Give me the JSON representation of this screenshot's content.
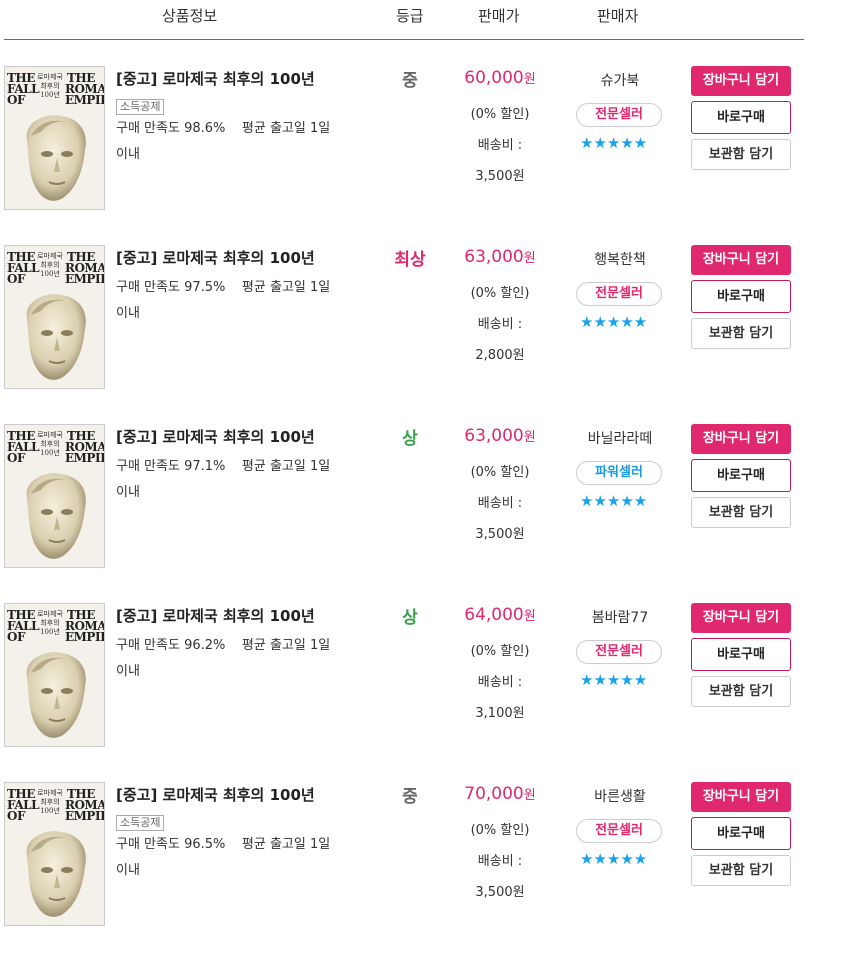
{
  "header": {
    "product_info": "상품정보",
    "grade": "등급",
    "price": "판매가",
    "seller": "판매자"
  },
  "cover": {
    "title_en_left": [
      "THE",
      "FALL",
      "OF"
    ],
    "title_en_right": [
      "THE",
      "ROMAN",
      "EMPIRE"
    ],
    "title_kr": [
      "로마제국",
      "최후의",
      "100년"
    ]
  },
  "labels": {
    "cart": "장바구니 담기",
    "buy": "바로구매",
    "wish": "보관함 담기",
    "deduction": "소득공제",
    "discount": "(0% 할인)",
    "shipping": "배송비 :",
    "won": "원",
    "stars": "★★★★★"
  },
  "colors": {
    "accent": "#e0286e",
    "power": "#1a9bdc",
    "grade_mid": "#666666",
    "grade_best": "#e0286e",
    "grade_high": "#3aa04a",
    "divider": "#1a8a93"
  },
  "items": [
    {
      "title": "[중고] 로마제국 최후의 100년",
      "deduction": true,
      "satisfaction": "구매 만족도 98.6%",
      "ship_time": "평균 출고일 1일",
      "ship_time2": "이내",
      "grade": "중",
      "grade_color": "#666666",
      "price": "60,000",
      "shipping_fee": "3,500원",
      "seller": "슈가북",
      "badge": "전문셀러",
      "badge_type": "pro"
    },
    {
      "title": "[중고] 로마제국 최후의 100년",
      "deduction": false,
      "satisfaction": "구매 만족도 97.5%",
      "ship_time": "평균 출고일 1일",
      "ship_time2": "이내",
      "grade": "최상",
      "grade_color": "#e0286e",
      "price": "63,000",
      "shipping_fee": "2,800원",
      "seller": "행복한책",
      "badge": "전문셀러",
      "badge_type": "pro"
    },
    {
      "title": "[중고] 로마제국 최후의 100년",
      "deduction": false,
      "satisfaction": "구매 만족도 97.1%",
      "ship_time": "평균 출고일 1일",
      "ship_time2": "이내",
      "grade": "상",
      "grade_color": "#3aa04a",
      "price": "63,000",
      "shipping_fee": "3,500원",
      "seller": "바닐라라떼",
      "badge": "파워셀러",
      "badge_type": "power"
    },
    {
      "title": "[중고] 로마제국 최후의 100년",
      "deduction": false,
      "satisfaction": "구매 만족도 96.2%",
      "ship_time": "평균 출고일 1일",
      "ship_time2": "이내",
      "grade": "상",
      "grade_color": "#3aa04a",
      "price": "64,000",
      "shipping_fee": "3,100원",
      "seller": "봄바람77",
      "badge": "전문셀러",
      "badge_type": "pro"
    },
    {
      "title": "[중고] 로마제국 최후의 100년",
      "deduction": true,
      "satisfaction": "구매 만족도 96.5%",
      "ship_time": "평균 출고일 1일",
      "ship_time2": "이내",
      "grade": "중",
      "grade_color": "#666666",
      "price": "70,000",
      "shipping_fee": "3,500원",
      "seller": "바른생활",
      "badge": "전문셀러",
      "badge_type": "pro"
    }
  ]
}
